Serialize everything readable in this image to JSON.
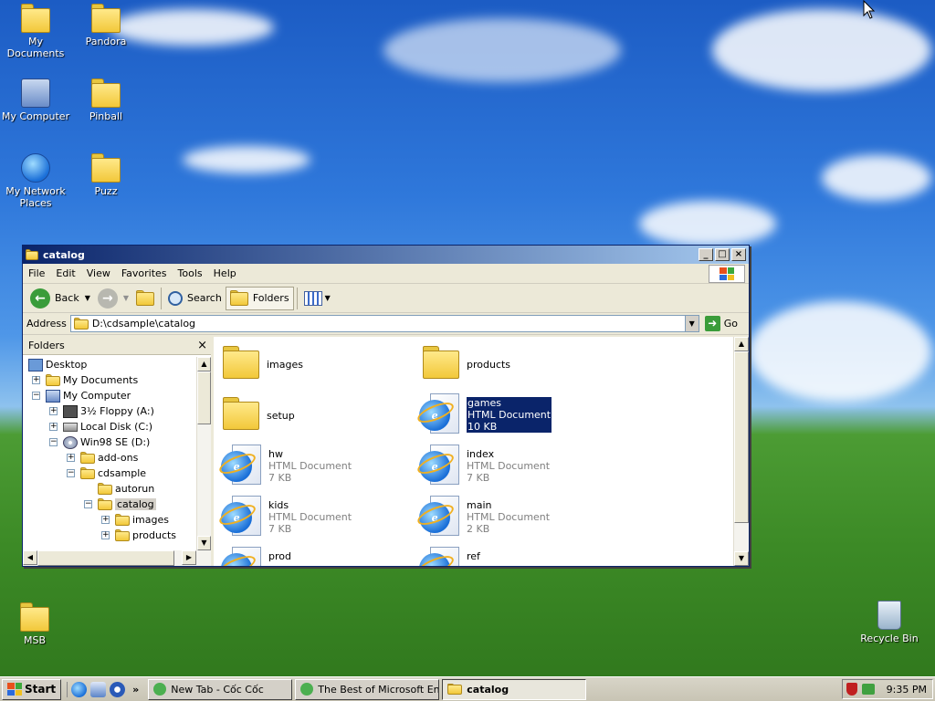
{
  "desktop": {
    "icons": [
      {
        "label": "My Documents",
        "icon": "my-documents-icon"
      },
      {
        "label": "Pandora",
        "icon": "folder-icon"
      },
      {
        "label": "My Computer",
        "icon": "my-computer-icon"
      },
      {
        "label": "Pinball",
        "icon": "folder-icon"
      },
      {
        "label": "My Network Places",
        "icon": "network-places-icon"
      },
      {
        "label": "Puzz",
        "icon": "folder-icon"
      },
      {
        "label": "MSB",
        "icon": "folder-icon"
      },
      {
        "label": "Recycle Bin",
        "icon": "recycle-bin-icon"
      }
    ]
  },
  "window": {
    "title": "catalog",
    "controls": {
      "minimize": "_",
      "maximize": "□",
      "close": "×"
    },
    "menu": [
      "File",
      "Edit",
      "View",
      "Favorites",
      "Tools",
      "Help"
    ],
    "toolbar": {
      "back": "Back",
      "search": "Search",
      "folders": "Folders"
    },
    "address": {
      "label": "Address",
      "value": "D:\\cdsample\\catalog",
      "go": "Go"
    },
    "folders_pane": {
      "title": "Folders",
      "close": "×",
      "tree": [
        {
          "label": "Desktop",
          "expander": "",
          "icon": "desktop-icon"
        },
        {
          "label": "My Documents",
          "expander": "+",
          "icon": "my-documents-icon"
        },
        {
          "label": "My Computer",
          "expander": "−",
          "icon": "my-computer-icon"
        },
        {
          "label": "3½ Floppy (A:)",
          "expander": "+",
          "icon": "floppy-icon"
        },
        {
          "label": "Local Disk (C:)",
          "expander": "+",
          "icon": "drive-icon"
        },
        {
          "label": "Win98 SE (D:)",
          "expander": "−",
          "icon": "cd-drive-icon"
        },
        {
          "label": "add-ons",
          "expander": "+",
          "icon": "folder-icon"
        },
        {
          "label": "cdsample",
          "expander": "−",
          "icon": "folder-icon"
        },
        {
          "label": "autorun",
          "expander": "",
          "icon": "folder-icon"
        },
        {
          "label": "catalog",
          "expander": "−",
          "icon": "folder-open-icon"
        },
        {
          "label": "images",
          "expander": "+",
          "icon": "folder-icon"
        },
        {
          "label": "products",
          "expander": "+",
          "icon": "folder-icon"
        }
      ]
    },
    "files": [
      {
        "name": "images",
        "type": "",
        "size": "",
        "kind": "folder"
      },
      {
        "name": "products",
        "type": "",
        "size": "",
        "kind": "folder"
      },
      {
        "name": "setup",
        "type": "",
        "size": "",
        "kind": "folder"
      },
      {
        "name": "games",
        "type": "HTML Document",
        "size": "10 KB",
        "kind": "html",
        "selected": true
      },
      {
        "name": "hw",
        "type": "HTML Document",
        "size": "7 KB",
        "kind": "html"
      },
      {
        "name": "index",
        "type": "HTML Document",
        "size": "7 KB",
        "kind": "html"
      },
      {
        "name": "kids",
        "type": "HTML Document",
        "size": "7 KB",
        "kind": "html"
      },
      {
        "name": "main",
        "type": "HTML Document",
        "size": "2 KB",
        "kind": "html"
      },
      {
        "name": "prod",
        "type": "",
        "size": "",
        "kind": "html"
      },
      {
        "name": "ref",
        "type": "",
        "size": "",
        "kind": "html"
      }
    ]
  },
  "taskbar": {
    "start": "Start",
    "quicklaunch_more": "»",
    "tasks": [
      {
        "label": "New Tab - Cốc Cốc"
      },
      {
        "label": "The Best of Microsoft En..."
      },
      {
        "label": "catalog",
        "active": true
      }
    ],
    "clock": "9:35 PM"
  },
  "colors": {
    "titlebar_start": "#0a246a",
    "titlebar_end": "#a6caf0",
    "selection": "#0a246a"
  }
}
